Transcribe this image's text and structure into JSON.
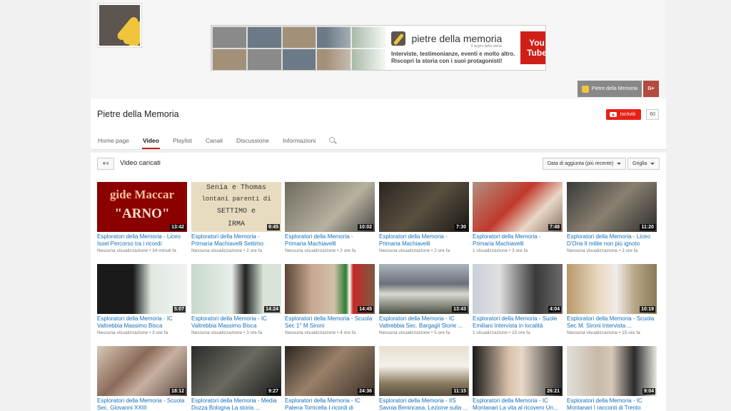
{
  "banner": {
    "brand_name": "pietre della memoria",
    "brand_tagline": "il segno della storia",
    "description_line1": "Interviste, testimonianze, eventi e molto altro.",
    "description_line2": "Riscopri la storia con i suoi protagonisti!",
    "youtube_logo_line1": "You",
    "youtube_logo_line2": "Tube"
  },
  "links": {
    "channel_link": "Pietre della Memoria",
    "gplus": "G+"
  },
  "channel": {
    "title": "Pietre della Memoria",
    "subscribe_label": "Iscriviti",
    "subscriber_count": "60"
  },
  "tabs": [
    {
      "label": "Home page"
    },
    {
      "label": "Video"
    },
    {
      "label": "Playlist"
    },
    {
      "label": "Canali"
    },
    {
      "label": "Discussione"
    },
    {
      "label": "Informazioni"
    }
  ],
  "toolbar": {
    "back_symbol": "↤",
    "section_title": "Video caricati",
    "sort_label": "Data di aggiunta (più recente)",
    "view_label": "Griglia"
  },
  "videos": [
    {
      "title": "Esploratori della Memoria - Liceo Issel Percorso tra i ricordi",
      "views": "Nessuna visualizzazione",
      "age": "34 minuti fa",
      "duration": "13:42",
      "thumb_text1": "gide Maccar",
      "thumb_text2": "\"ARNO\""
    },
    {
      "title": "Esploratori della Memoria - Primaria Machiavelli Settimo",
      "views": "Nessuna visualizzazione",
      "age": "2 ore fa",
      "duration": "9:45",
      "thumb_text1": "Senia e Thomas",
      "thumb_text2": "lontani parenti di",
      "thumb_text3": "SETTIMO e",
      "thumb_text4": "IRMA"
    },
    {
      "title": "Esploratori della Memoria - Primaria Machiavelli",
      "views": "Nessuna visualizzazione",
      "age": "2 ore fa",
      "duration": "10:02"
    },
    {
      "title": "Esploratori della Memoria - Primaria Machiavelli",
      "views": "Nessuna visualizzazione",
      "age": "2 ore fa",
      "duration": "7:30"
    },
    {
      "title": "Esploratori della Memoria - Primaria Machiavelli",
      "views": "1 visualizzazione",
      "age": "3 ore fa",
      "duration": "7:48"
    },
    {
      "title": "Esploratori della Memoria - Liceo D'Oria Il milite non più ignoto",
      "views": "Nessuna visualizzazione",
      "age": "3 ore fa",
      "duration": "11:20"
    },
    {
      "title": "Esploratori della Memoria - IC Valtrebbia Massimo Bisca",
      "views": "Nessuna visualizzazione",
      "age": "3 ore fa",
      "duration": "5:07"
    },
    {
      "title": "Esploratori della Memoria - IC Valtrebbia Massimo Bisca",
      "views": "Nessuna visualizzazione",
      "age": "3 ore fa",
      "duration": "14:24"
    },
    {
      "title": "Esploratori della Memoria - Scuola Sec 1° M Sironi",
      "views": "Nessuna visualizzazione",
      "age": "4 ore fa",
      "duration": "14:45"
    },
    {
      "title": "Esploratori della Memoria - IC Valtrebbia Sec. Bargagli Storie ...",
      "views": "Nessuna visualizzazione",
      "age": "5 ore fa",
      "duration": "13:43"
    },
    {
      "title": "Esploratori della Memoria - Suole Emiliani Intervista in località",
      "views": "1 visualizzazione",
      "age": "15 ore fa",
      "duration": "4:04"
    },
    {
      "title": "Esploratori della Memoria - Scuola Sec M. Sironi Intervista ...",
      "views": "Nessuna visualizzazione",
      "age": "15 ore fa",
      "duration": "10:19"
    },
    {
      "title": "Esploratori della Memoria - Scuola Sec. Giovanni XXIII",
      "views": "",
      "age": "",
      "duration": "18:12"
    },
    {
      "title": "Esploratori della Memoria - Media Dozza Bologna La storia ...",
      "views": "",
      "age": "",
      "duration": "9:27"
    },
    {
      "title": "Esploratori della Memoria - IC Palena Torricella I ricordi di",
      "views": "",
      "age": "",
      "duration": "24:36"
    },
    {
      "title": "Esploratori della Memoria - IIS Savoia Benincasa. Lezione sulla ...",
      "views": "",
      "age": "",
      "duration": "11:15"
    },
    {
      "title": "Esploratori della Memoria - IC Montanari La vita al ricovero Un...",
      "views": "",
      "age": "",
      "duration": "26:21"
    },
    {
      "title": "Esploratori della Memoria - IC Montanari I racconti di Trento",
      "views": "",
      "age": "",
      "duration": "9:04"
    }
  ]
}
